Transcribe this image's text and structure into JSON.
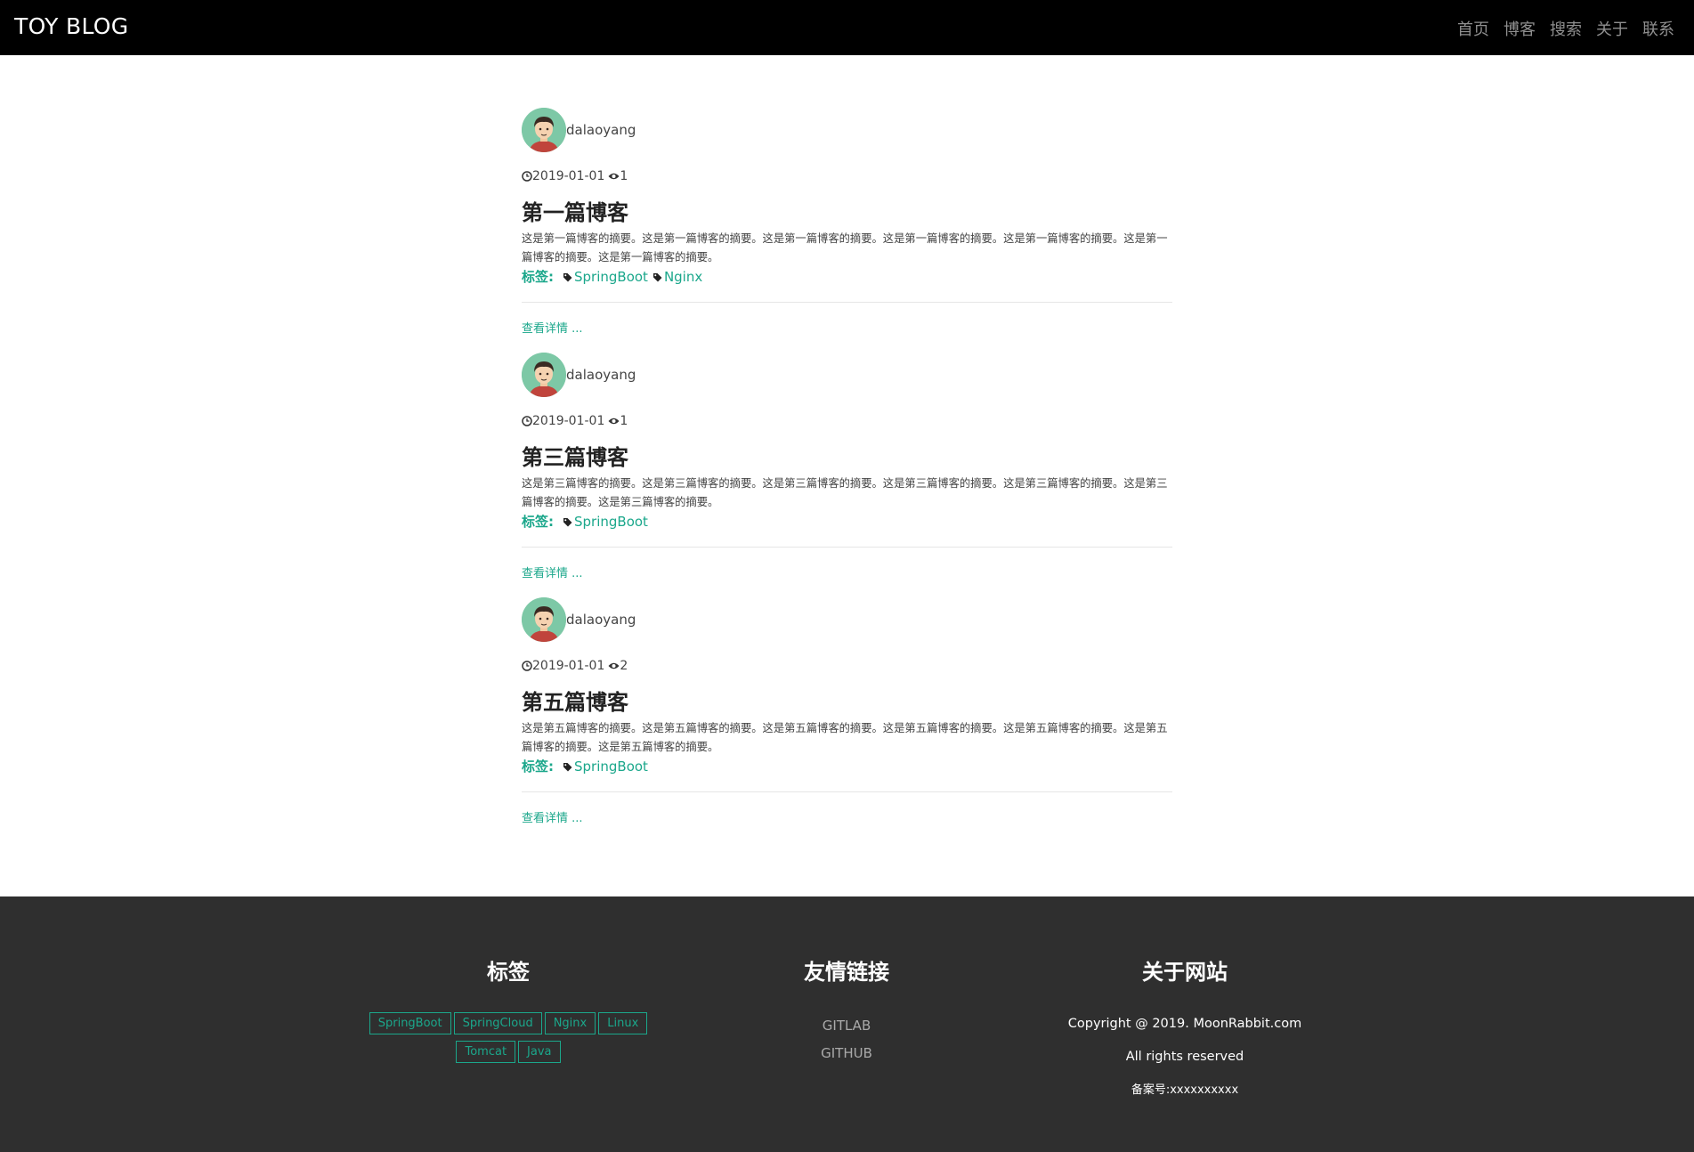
{
  "header": {
    "brand": "TOY BLOG",
    "nav": [
      "首页",
      "博客",
      "搜索",
      "关于",
      "联系"
    ]
  },
  "posts": [
    {
      "author": "dalaoyang",
      "date": "2019-01-01",
      "views": "1",
      "title": "第一篇博客",
      "summary": "这是第一篇博客的摘要。这是第一篇博客的摘要。这是第一篇博客的摘要。这是第一篇博客的摘要。这是第一篇博客的摘要。这是第一篇博客的摘要。这是第一篇博客的摘要。",
      "tags_label": "标签:",
      "tags": [
        "SpringBoot",
        "Nginx"
      ],
      "more": "查看详情 ..."
    },
    {
      "author": "dalaoyang",
      "date": "2019-01-01",
      "views": "1",
      "title": "第三篇博客",
      "summary": "这是第三篇博客的摘要。这是第三篇博客的摘要。这是第三篇博客的摘要。这是第三篇博客的摘要。这是第三篇博客的摘要。这是第三篇博客的摘要。这是第三篇博客的摘要。",
      "tags_label": "标签:",
      "tags": [
        "SpringBoot"
      ],
      "more": "查看详情 ..."
    },
    {
      "author": "dalaoyang",
      "date": "2019-01-01",
      "views": "2",
      "title": "第五篇博客",
      "summary": "这是第五篇博客的摘要。这是第五篇博客的摘要。这是第五篇博客的摘要。这是第五篇博客的摘要。这是第五篇博客的摘要。这是第五篇博客的摘要。这是第五篇博客的摘要。",
      "tags_label": "标签:",
      "tags": [
        "SpringBoot"
      ],
      "more": "查看详情 ..."
    }
  ],
  "footer": {
    "tags_title": "标签",
    "tags": [
      "SpringBoot",
      "SpringCloud",
      "Nginx",
      "Linux",
      "Tomcat",
      "Java"
    ],
    "links_title": "友情链接",
    "links": [
      "GITLAB",
      "GITHUB"
    ],
    "about_title": "关于网站",
    "copyright": "Copyright @ 2019. MoonRabbit.com",
    "rights": "All rights reserved",
    "icp": "备案号:xxxxxxxxxx"
  },
  "colors": {
    "accent": "#1ba78b",
    "header_bg": "#000000",
    "footer_bg": "#2f2f2f"
  },
  "icons": {
    "avatar": "avatar",
    "date": "clock-icon",
    "views": "eye-icon",
    "tag": "tag-icon"
  }
}
